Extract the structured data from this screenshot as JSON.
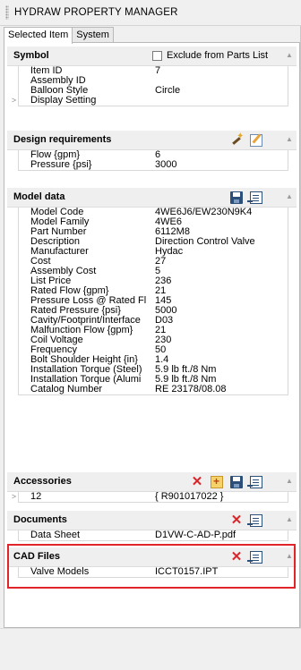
{
  "title": "HYDRAW PROPERTY MANAGER",
  "tabs": [
    {
      "label": "Selected Item"
    },
    {
      "label": "System"
    }
  ],
  "symbol": {
    "title": "Symbol",
    "exclude_label": "Exclude from Parts List",
    "exclude_checked": false,
    "rows": [
      {
        "name": "Item ID",
        "value": "7"
      },
      {
        "name": "Assembly ID",
        "value": ""
      },
      {
        "name": "Balloon Style",
        "value": "Circle"
      },
      {
        "name": "Display Setting",
        "value": ""
      }
    ]
  },
  "design": {
    "title": "Design requirements",
    "rows": [
      {
        "name": "Flow {gpm}",
        "value": "6"
      },
      {
        "name": "Pressure {psi}",
        "value": "3000"
      }
    ]
  },
  "model": {
    "title": "Model data",
    "rows": [
      {
        "name": "Model Code",
        "value": "4WE6J6/EW230N9K4"
      },
      {
        "name": "Model Family",
        "value": "4WE6"
      },
      {
        "name": "Part Number",
        "value": "6112M8"
      },
      {
        "name": "Description",
        "value": "Direction Control Valve"
      },
      {
        "name": "Manufacturer",
        "value": "Hydac"
      },
      {
        "name": "Cost",
        "value": "27"
      },
      {
        "name": "Assembly Cost",
        "value": "5"
      },
      {
        "name": "List Price",
        "value": "236"
      },
      {
        "name": "Rated Flow {gpm}",
        "value": "21"
      },
      {
        "name": "Pressure Loss @ Rated Fl",
        "value": "145"
      },
      {
        "name": "Rated Pressure {psi}",
        "value": "5000"
      },
      {
        "name": "Cavity/Footprint/Interface",
        "value": "D03"
      },
      {
        "name": "Malfunction Flow {gpm}",
        "value": "21"
      },
      {
        "name": "Coil Voltage",
        "value": "230"
      },
      {
        "name": "Frequency",
        "value": "50"
      },
      {
        "name": "Bolt Shoulder Height {in}",
        "value": "1.4"
      },
      {
        "name": "Installation Torque (Steel)",
        "value": "5.9 lb ft./8 Nm"
      },
      {
        "name": "Installation Torque (Alumi",
        "value": "5.9 lb ft./8 Nm"
      },
      {
        "name": "Catalog Number",
        "value": "RE 23178/08.08"
      }
    ]
  },
  "accessories": {
    "title": "Accessories",
    "rows": [
      {
        "name": "12",
        "value": "{ R901017022 }"
      }
    ]
  },
  "documents": {
    "title": "Documents",
    "rows": [
      {
        "name": "Data Sheet",
        "value": "D1VW-C-AD-P.pdf"
      }
    ]
  },
  "cad": {
    "title": "CAD Files",
    "highlight_color": "#e0242a",
    "rows": [
      {
        "name": "Valve Models",
        "value": "ICCT0157.IPT"
      }
    ]
  }
}
